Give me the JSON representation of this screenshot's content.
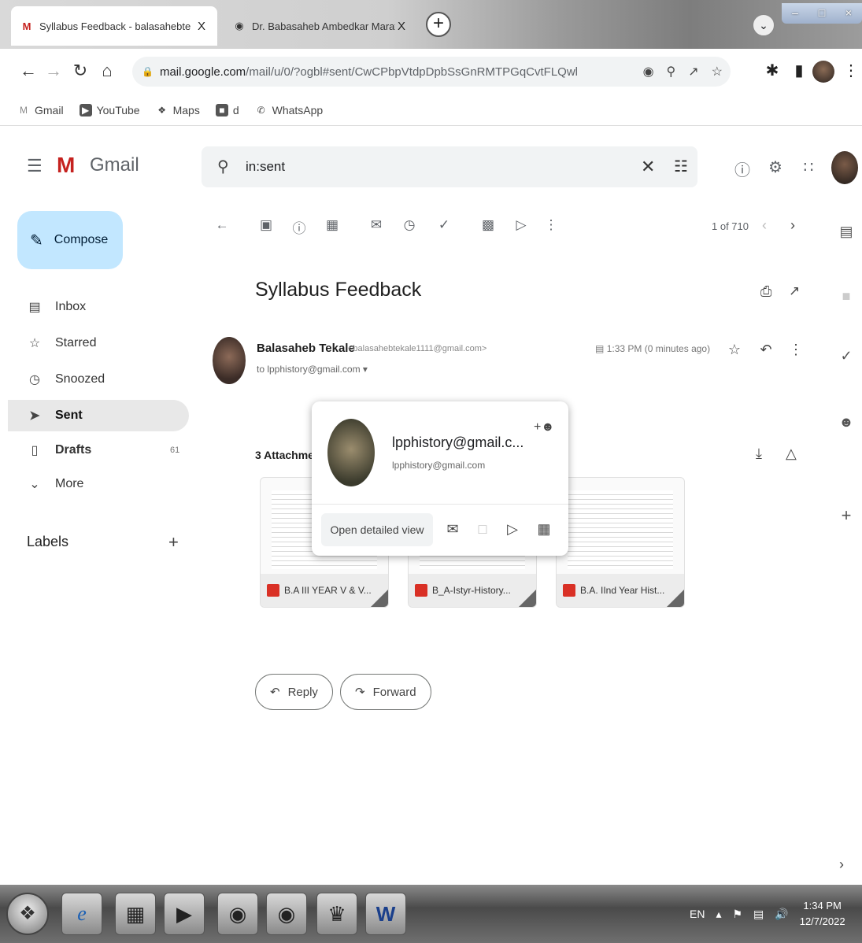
{
  "browser": {
    "tabs": [
      {
        "title": "Syllabus Feedback - balasahebte",
        "favicon": "gmail-icon",
        "close": "X"
      },
      {
        "title": "Dr. Babasaheb Ambedkar Marat",
        "favicon": "chrome-globe-icon",
        "close": "X"
      }
    ],
    "new_tab": "+",
    "url_host": "mail.google.com",
    "url_path": "/mail/u/0/?ogbl#sent/CwCPbpVtdpDpbSsGnRMTPGqCvtFLQwl",
    "bookmarks": [
      {
        "label": "Gmail",
        "icon": "gmail-icon"
      },
      {
        "label": "YouTube",
        "icon": "youtube-icon"
      },
      {
        "label": "Maps",
        "icon": "maps-icon"
      },
      {
        "label": "d",
        "icon": "bookmark-icon"
      },
      {
        "label": "WhatsApp",
        "icon": "whatsapp-icon"
      }
    ]
  },
  "gmail": {
    "product_name": "Gmail",
    "search_query": "in:sent",
    "compose_label": "Compose",
    "nav": [
      {
        "label": "Inbox",
        "icon": "inbox-icon",
        "count": ""
      },
      {
        "label": "Starred",
        "icon": "star-icon",
        "count": ""
      },
      {
        "label": "Snoozed",
        "icon": "clock-icon",
        "count": ""
      },
      {
        "label": "Sent",
        "icon": "send-icon",
        "count": ""
      },
      {
        "label": "Drafts",
        "icon": "draft-icon",
        "count": "61"
      },
      {
        "label": "More",
        "icon": "chevron-down-icon",
        "count": ""
      }
    ],
    "labels_header": "Labels",
    "labels_add": "+",
    "pager": "1 of 710",
    "message": {
      "subject": "Syllabus Feedback",
      "sender_name": "Balasaheb Tekale",
      "sender_email": "<balasahebtekale1111@gmail.com>",
      "to_line": "to lpphistory@gmail.com",
      "time": "1:33 PM (0 minutes ago)",
      "attachments_header": "3 Attachme",
      "attachments": [
        {
          "name": "B.A III YEAR V & V..."
        },
        {
          "name": "B_A-Istyr-History..."
        },
        {
          "name": "B.A. IInd Year Hist..."
        }
      ],
      "reply_label": "Reply",
      "forward_label": "Forward"
    },
    "hovercard": {
      "name": "lpphistory@gmail.c...",
      "email": "lpphistory@gmail.com",
      "detail_label": "Open detailed view"
    }
  },
  "taskbar": {
    "lang": "EN",
    "time": "1:34 PM",
    "date": "12/7/2022"
  },
  "colors": {
    "compose_bg": "#c2e7ff",
    "gmail_red": "#c5221f",
    "pdf_red": "#d93025",
    "selected_nav": "#e8e8e8"
  }
}
